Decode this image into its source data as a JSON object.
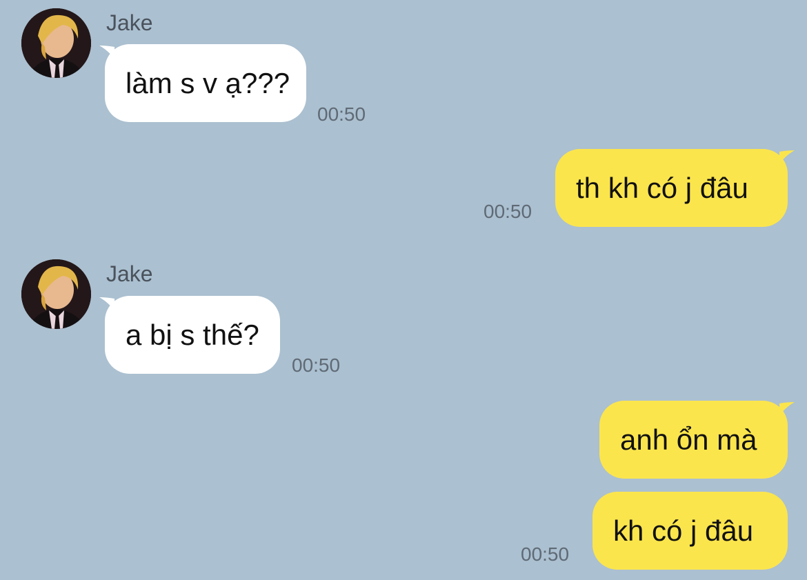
{
  "colors": {
    "background": "#abc0d0",
    "incoming_bubble": "#ffffff",
    "outgoing_bubble": "#fbe54d",
    "timestamp": "#5f6a75",
    "sender_name": "#4a525c"
  },
  "conversation": [
    {
      "direction": "incoming",
      "sender": "Jake",
      "avatar_icon": "profile-photo",
      "text": "làm s v ạ???",
      "time": "00:50"
    },
    {
      "direction": "outgoing",
      "text": "th kh có j đâu",
      "time": "00:50"
    },
    {
      "direction": "incoming",
      "sender": "Jake",
      "avatar_icon": "profile-photo",
      "text": "a bị s thế?",
      "time": "00:50"
    },
    {
      "direction": "outgoing",
      "text": "anh ổn mà",
      "time": ""
    },
    {
      "direction": "outgoing",
      "text": "kh có j đâu",
      "time": "00:50"
    }
  ]
}
